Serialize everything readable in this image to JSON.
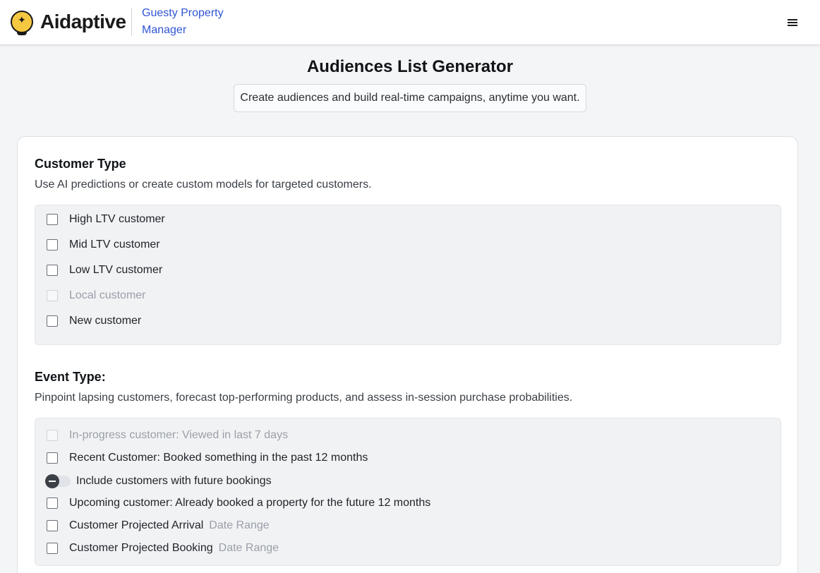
{
  "header": {
    "brand": "Aidaptive",
    "company": "Guesty Property Manager",
    "menu_icon": "hamburger-icon",
    "logo_icon": "sparkle-bulb-icon"
  },
  "page": {
    "title": "Audiences List Generator",
    "subtitle": "Create audiences and build real-time campaigns, anytime you want."
  },
  "customer_type": {
    "title": "Customer Type",
    "description": "Use AI predictions or create custom models for targeted customers.",
    "options": [
      {
        "label": "High LTV customer",
        "checked": false,
        "disabled": false
      },
      {
        "label": "Mid LTV customer",
        "checked": false,
        "disabled": false
      },
      {
        "label": "Low LTV customer",
        "checked": false,
        "disabled": false
      },
      {
        "label": "Local customer",
        "checked": false,
        "disabled": true
      },
      {
        "label": "New customer",
        "checked": false,
        "disabled": false
      }
    ]
  },
  "event_type": {
    "title": "Event Type:",
    "description": "Pinpoint lapsing customers, forecast top-performing products, and assess in-session purchase probabilities.",
    "options": [
      {
        "label": "In-progress customer: Viewed in last 7 days",
        "checked": false,
        "disabled": true
      },
      {
        "label": "Recent Customer: Booked something in the past 12 months",
        "checked": false,
        "disabled": false
      },
      {
        "label": "Include customers with future bookings",
        "type": "toggle",
        "on": false
      },
      {
        "label": "Upcoming customer: Already booked a property for the future 12 months",
        "checked": false,
        "disabled": false
      },
      {
        "label": "Customer Projected Arrival",
        "extra": "Date Range",
        "checked": false,
        "disabled": false
      },
      {
        "label": "Customer Projected Booking",
        "extra": "Date Range",
        "checked": false,
        "disabled": false
      }
    ]
  },
  "colors": {
    "link": "#2f55d4",
    "logo_yellow": "#f5c842",
    "panel_bg": "#f1f2f4"
  }
}
